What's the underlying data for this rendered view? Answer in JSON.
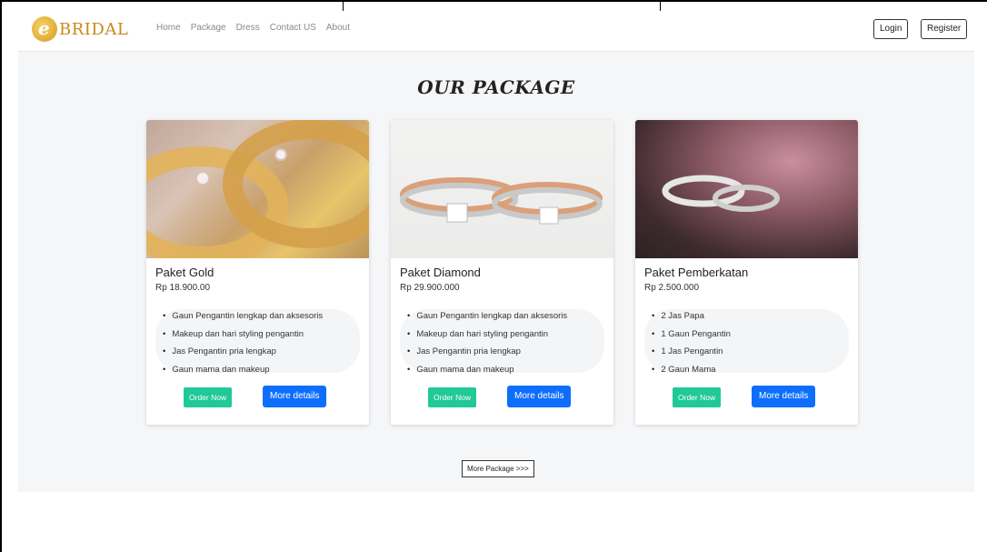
{
  "brand": {
    "logo_letter": "e",
    "logo_text": "BRIDAL"
  },
  "nav": {
    "links": [
      "Home",
      "Package",
      "Dress",
      "Contact US",
      "About"
    ]
  },
  "auth": {
    "login": "Login",
    "register": "Register"
  },
  "section_title": "OUR PACKAGE",
  "packages": [
    {
      "title": "Paket Gold",
      "price": "Rp 18.900.00",
      "features": [
        "Gaun Pengantin lengkap dan aksesoris",
        "Makeup dan hari styling pengantin",
        "Jas Pengantin pria lengkap",
        "Gaun mama dan makeup"
      ],
      "order_label": "Order Now",
      "details_label": "More details"
    },
    {
      "title": "Paket Diamond",
      "price": "Rp 29.900.000",
      "features": [
        "Gaun Pengantin lengkap dan aksesoris",
        "Makeup dan hari styling pengantin",
        "Jas Pengantin pria lengkap",
        "Gaun mama dan makeup"
      ],
      "order_label": "Order Now",
      "details_label": "More details"
    },
    {
      "title": "Paket Pemberkatan",
      "price": "Rp 2.500.000",
      "features": [
        "2 Jas Papa",
        "1 Gaun Pengantin",
        "1 Jas Pengantin",
        "2 Gaun Mama"
      ],
      "order_label": "Order Now",
      "details_label": "More details"
    }
  ],
  "more_package_label": "More Package >>>",
  "colors": {
    "brand_gold": "#c9891c",
    "order_green": "#20c997",
    "details_blue": "#0d6efd",
    "page_bg": "#f5f6f8"
  }
}
